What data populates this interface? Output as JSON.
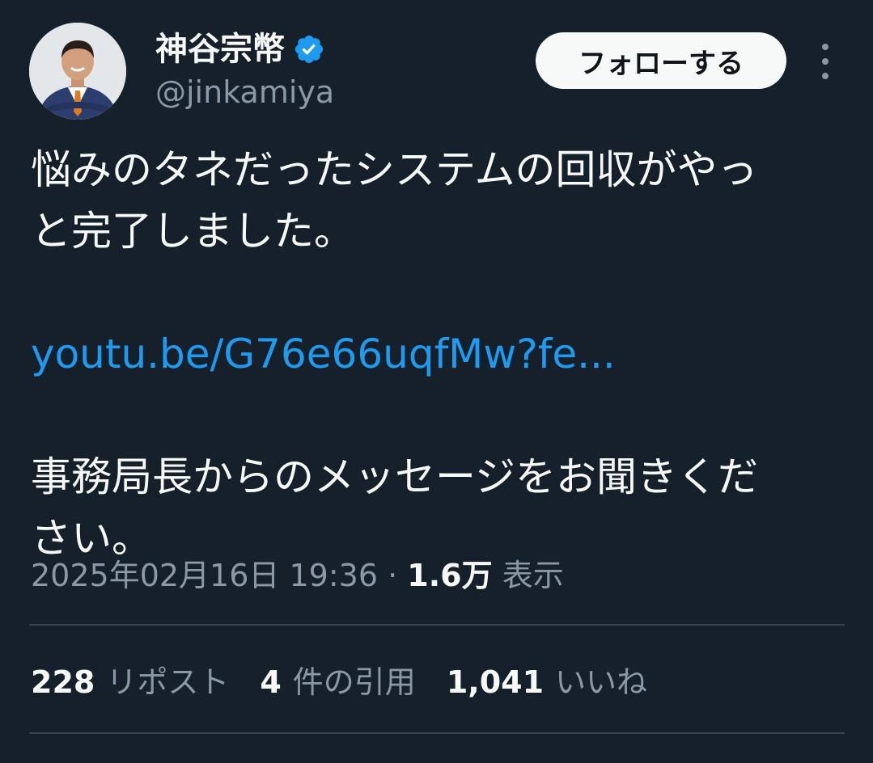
{
  "author": {
    "display_name": "神谷宗幣",
    "handle": "@jinkamiya",
    "verified": true,
    "avatar_icon": "person-photo-avatar"
  },
  "actions": {
    "follow_label": "フォローする",
    "more_icon": "more-vertical-icon"
  },
  "tweet": {
    "lines": [
      "悩みのタネだったシステムの回収がやっ",
      "と完了しました。",
      "",
      "youtu.be/G76e66uqfMw?fe...",
      "",
      "事務局長からのメッセージをお聞きくだ",
      "さい。"
    ],
    "timestamp": "2025年02月16日 19:36",
    "separator": "·",
    "views_count": "1.6万",
    "views_label": "表示"
  },
  "stats": {
    "reposts": {
      "count": "228",
      "label": "リポスト"
    },
    "quotes": {
      "count": "4",
      "label": "件の引用"
    },
    "likes": {
      "count": "1,041",
      "label": "いいね"
    }
  },
  "colors": {
    "background": "#15202b",
    "link": "#1d9bf0",
    "secondary_text": "#8b98a5",
    "verified_badge": "#1d9bf0"
  }
}
